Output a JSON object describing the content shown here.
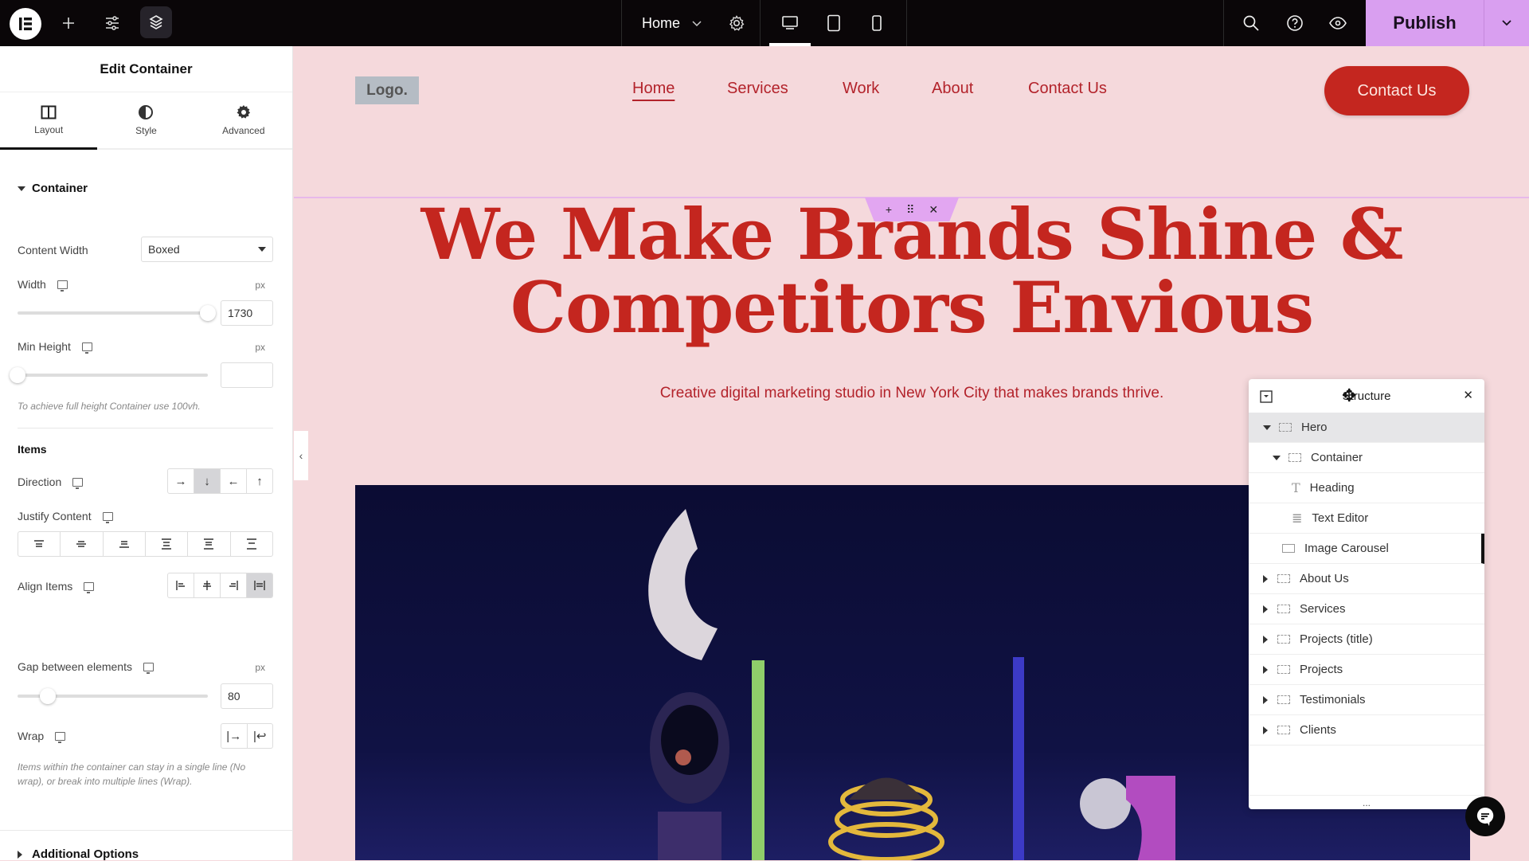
{
  "topbar": {
    "page_name": "Home",
    "publish_label": "Publish",
    "accent_color": "#d99ff0",
    "icons": [
      "elementor-logo-icon",
      "plus-icon",
      "sliders-icon",
      "layers-icon",
      "settings-gear-icon",
      "desktop-icon",
      "tablet-icon",
      "mobile-icon",
      "search-icon",
      "help-icon",
      "preview-eye-icon",
      "chevron-down-icon"
    ]
  },
  "panel": {
    "title": "Edit Container",
    "tabs": [
      {
        "label": "Layout",
        "active": true
      },
      {
        "label": "Style",
        "active": false
      },
      {
        "label": "Advanced",
        "active": false
      }
    ],
    "section_container": "Container",
    "content_width_label": "Content Width",
    "content_width_value": "Boxed",
    "width_label": "Width",
    "width_unit": "px",
    "width_value": "1730",
    "min_height_label": "Min Height",
    "min_height_unit": "px",
    "min_height_value": "",
    "min_height_hint": "To achieve full height Container use 100vh.",
    "items_heading": "Items",
    "direction_label": "Direction",
    "direction_options": [
      "→",
      "↓",
      "←",
      "↑"
    ],
    "direction_selected": "↓",
    "justify_label": "Justify Content",
    "align_label": "Align Items",
    "gap_label": "Gap between elements",
    "gap_unit": "px",
    "gap_value": "80",
    "wrap_label": "Wrap",
    "wrap_options": [
      "|→",
      "|↩"
    ],
    "wrap_hint": "Items within the container can stay in a single line (No wrap), or break into multiple lines (Wrap).",
    "additional_options": "Additional Options"
  },
  "site": {
    "logo": "Logo.",
    "nav": [
      "Home",
      "Services",
      "Work",
      "About",
      "Contact Us"
    ],
    "nav_active": "Home",
    "cta": "Contact Us",
    "hero_title_line1": "We Make Brands Shine &",
    "hero_title_line2": "Competitors Envious",
    "hero_subtitle": "Creative digital marketing studio in New York City that makes brands thrive.",
    "brand_color": "#c4261f",
    "background_color": "#f5d9dc"
  },
  "structure": {
    "title": "Structure",
    "items": [
      {
        "label": "Hero",
        "level": 0,
        "toggle": "expanded",
        "icon": "container-icon",
        "highlight": true
      },
      {
        "label": "Container",
        "level": 1,
        "toggle": "expanded",
        "icon": "container-icon"
      },
      {
        "label": "Heading",
        "level": 2,
        "toggle": "none",
        "icon": "heading-icon"
      },
      {
        "label": "Text Editor",
        "level": 2,
        "toggle": "none",
        "icon": "text-editor-icon"
      },
      {
        "label": "Image Carousel",
        "level": 1,
        "toggle": "none",
        "icon": "carousel-icon"
      },
      {
        "label": "About Us",
        "level": 0,
        "toggle": "collapsed",
        "icon": "container-icon"
      },
      {
        "label": "Services",
        "level": 0,
        "toggle": "collapsed",
        "icon": "container-icon"
      },
      {
        "label": "Projects (title)",
        "level": 0,
        "toggle": "collapsed",
        "icon": "container-icon"
      },
      {
        "label": "Projects",
        "level": 0,
        "toggle": "collapsed",
        "icon": "container-icon"
      },
      {
        "label": "Testimonials",
        "level": 0,
        "toggle": "collapsed",
        "icon": "container-icon"
      },
      {
        "label": "Clients",
        "level": 0,
        "toggle": "collapsed",
        "icon": "container-icon"
      }
    ],
    "footer": "..."
  }
}
